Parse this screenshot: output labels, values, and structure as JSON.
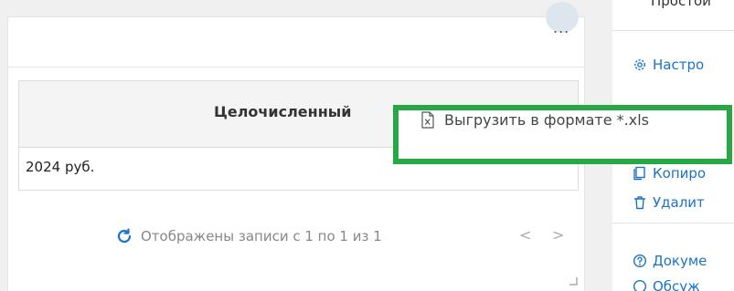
{
  "card": {
    "more_label": "...",
    "table": {
      "column_header": "Целочисленный",
      "cell_value": "2024 руб."
    },
    "pager": {
      "status": "Отображены записи с 1 по 1 из 1",
      "prev": "<",
      "next": ">"
    }
  },
  "sidebar": {
    "title": "Простой",
    "items": [
      {
        "label": "Настро"
      },
      {
        "label": "Копиро"
      },
      {
        "label": "Удалит"
      },
      {
        "label": "Докуме"
      },
      {
        "label": "Обсуж"
      }
    ]
  },
  "context_menu": {
    "items": [
      {
        "label": "Выгрузить в формате *.xls",
        "icon": "xls-file-icon"
      }
    ]
  },
  "colors": {
    "accent": "#1a73c8",
    "highlight": "#28a745",
    "header_bg": "#f4f4f4"
  }
}
